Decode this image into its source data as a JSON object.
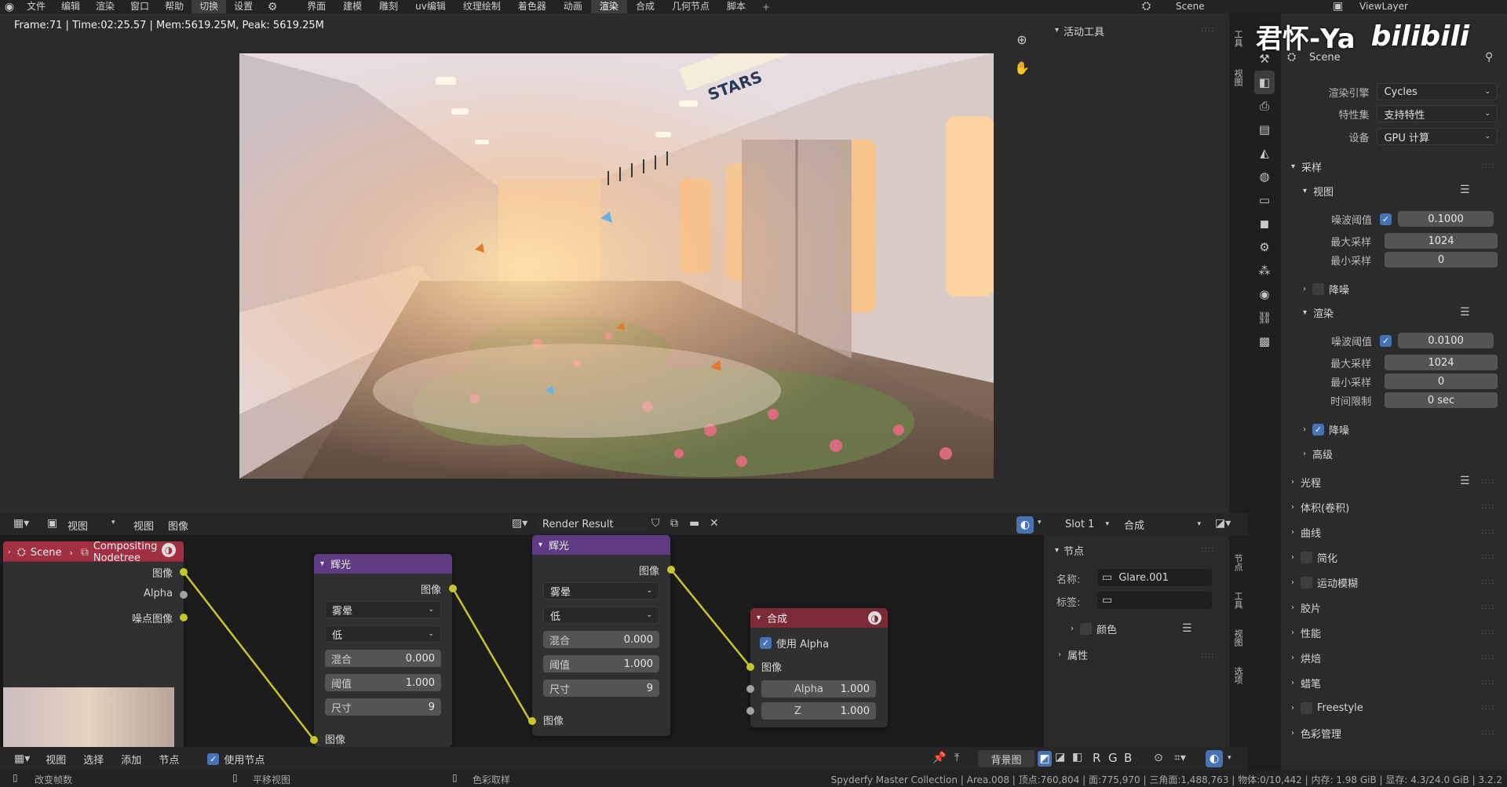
{
  "topbar": {
    "menus": [
      "文件",
      "编辑",
      "渲染",
      "窗口",
      "帮助",
      "切换",
      "设置"
    ],
    "workspaces": [
      "界面",
      "建模",
      "雕刻",
      "uv编辑",
      "纹理绘制",
      "着色器",
      "动画",
      "渲染",
      "合成",
      "几何节点",
      "脚本"
    ],
    "active_workspace": "渲染",
    "add": "+",
    "scene": "Scene",
    "view_layer": "ViewLayer"
  },
  "watermark": {
    "name": "君怀-Ya",
    "site": "bilibili"
  },
  "viewer": {
    "frame_info": "Frame:71 | Time:02:25.57 | Mem:5619.25M, Peak: 5619.25M",
    "train_sign": "STARS",
    "side_panel": {
      "title": "活动工具"
    },
    "side_tabs": [
      "工具",
      "视图"
    ]
  },
  "image_header": {
    "view_mode": "视图",
    "menus": [
      "视图",
      "图像"
    ],
    "image_name": "Render Result",
    "slot": "Slot 1",
    "pass": "合成"
  },
  "node_editor": {
    "breadcrumb_scene": "Scene",
    "breadcrumb_tree": "Compositing Nodetree",
    "render_layers": {
      "outputs": [
        "图像",
        "Alpha",
        "噪点图像"
      ]
    },
    "glare1": {
      "title": "辉光",
      "out": "图像",
      "type": "雾晕",
      "quality": "低",
      "mix_label": "混合",
      "mix": "0.000",
      "thresh_label": "阈值",
      "thresh": "1.000",
      "size_label": "尺寸",
      "size": "9",
      "in": "图像"
    },
    "glare2": {
      "title": "辉光",
      "out": "图像",
      "type": "雾晕",
      "quality": "低",
      "mix_label": "混合",
      "mix": "0.000",
      "thresh_label": "阈值",
      "thresh": "1.000",
      "size_label": "尺寸",
      "size": "9",
      "in": "图像"
    },
    "composite": {
      "title": "合成",
      "use_alpha": "使用 Alpha",
      "in_image": "图像",
      "alpha_label": "Alpha",
      "alpha": "1.000",
      "z_label": "Z",
      "z": "1.000"
    },
    "footer_menus": [
      "视图",
      "选择",
      "添加",
      "节点"
    ],
    "use_nodes": "使用节点",
    "backdrop": "背景图",
    "channels": [
      "R",
      "G",
      "B"
    ]
  },
  "node_panel": {
    "section": "节点",
    "name_label": "名称:",
    "name": "Glare.001",
    "label_label": "标签:",
    "color": "颜色",
    "props": "属性",
    "side_tabs": [
      "节点",
      "工具",
      "视图",
      "选项"
    ]
  },
  "properties": {
    "scene": "Scene",
    "engine_label": "渲染引擎",
    "engine": "Cycles",
    "feature_label": "特性集",
    "feature": "支持特性",
    "device_label": "设备",
    "device": "GPU 计算",
    "sampling": "采样",
    "viewport": {
      "title": "视图",
      "noise_label": "噪波阈值",
      "noise": "0.1000",
      "max_label": "最大采样",
      "max": "1024",
      "min_label": "最小采样",
      "min": "0",
      "denoise": "降噪"
    },
    "render": {
      "title": "渲染",
      "noise_label": "噪波阈值",
      "noise": "0.0100",
      "max_label": "最大采样",
      "max": "1024",
      "min_label": "最小采样",
      "min": "0",
      "time_label": "时间限制",
      "time": "0 sec",
      "denoise": "降噪",
      "advanced": "高级"
    },
    "sections": [
      "光程",
      "体积(卷积)",
      "曲线",
      "简化",
      "运动模糊",
      "胶片",
      "性能",
      "烘焙",
      "蜡笔",
      "Freestyle",
      "色彩管理"
    ]
  },
  "statusbar": {
    "left1": "改变帧数",
    "left2": "平移视图",
    "left3": "色彩取样",
    "right": "Spyderfy Master Collection | Area.008 | 顶点:760,804 | 面:775,970 | 三角面:1,488,763 | 物体:0/10,442 | 内存: 1.98 GiB | 显存: 4.3/24.0 GiB | 3.2.2"
  },
  "colors": {
    "accent": "#4772b3",
    "socket_yellow": "#c7c729",
    "glare_header": "#5e3b82",
    "composite_header": "#7a2b35"
  }
}
